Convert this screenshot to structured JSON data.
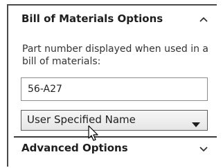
{
  "bom_options": {
    "title": "Bill of Materials Options",
    "collapse_icon": "chevron-up-icon",
    "description": "Part number displayed when used in a bill of materials:",
    "part_number_value": "56-A27",
    "part_number_source": {
      "selected": "User Specified Name",
      "icon": "dropdown-arrow-icon"
    }
  },
  "advanced_options": {
    "title": "Advanced Options",
    "expand_icon": "chevron-down-icon"
  },
  "cursor": "mouse-pointer-icon"
}
